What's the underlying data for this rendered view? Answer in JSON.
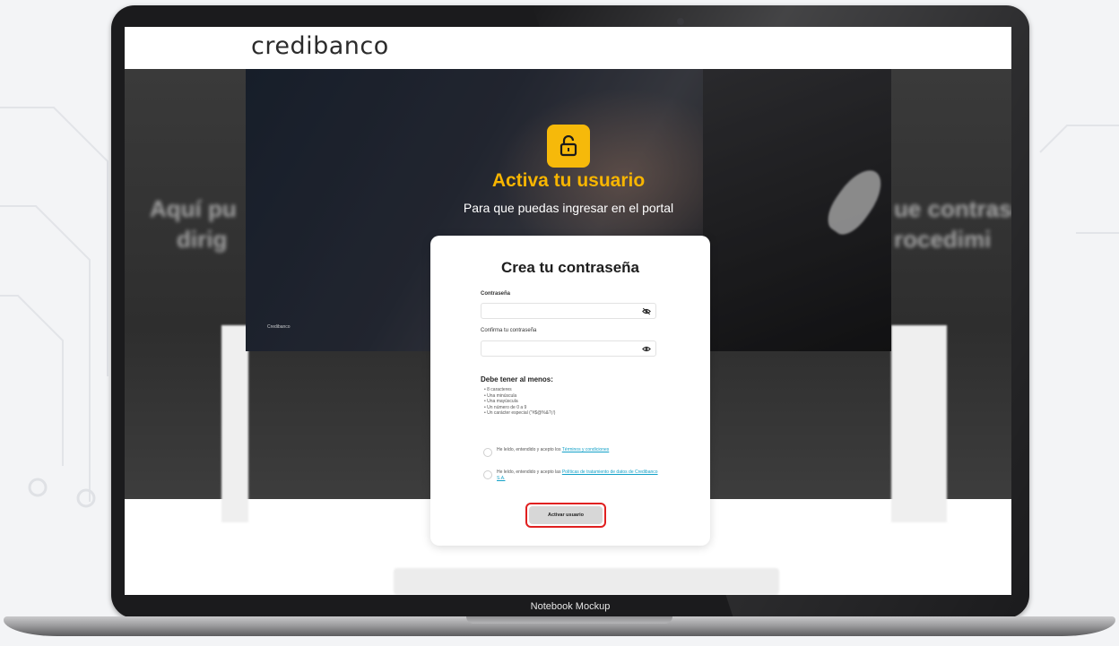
{
  "site": {
    "logo_text": "credibanco",
    "side_text_left_1": "Aquí pu",
    "side_text_left_2": "dirig",
    "side_text_right_1": "ue contrase",
    "side_text_right_2": "rocedimi"
  },
  "hero": {
    "title": "Activa tu usuario",
    "subtitle": "Para que puedas ingresar en el portal",
    "credit": "Credibanco",
    "lock_icon": "unlock-icon"
  },
  "form": {
    "title": "Crea tu contraseña",
    "password_label": "Contraseña",
    "password_value": "",
    "confirm_label": "Confirma tu contraseña",
    "confirm_value": "",
    "requirements_title": "Debe tener al menos:",
    "requirements": [
      "• 8 caracteres",
      "• Una minúscula",
      "• Una mayúscula",
      "• Un número de 0 a 9",
      "• Un carácter especial (\"#$@%&?¡!)"
    ],
    "terms_prefix": "He leído, entendido y acepto los ",
    "terms_link": "Términos y condiciones",
    "privacy_prefix": "He leído, entendido y acepto las ",
    "privacy_link": "Políticas de tratamiento de datos de Credibanco S.A.",
    "submit_label": "Activar usuario"
  },
  "caption": "Notebook Mockup",
  "colors": {
    "accent_yellow": "#f6b90a",
    "highlight_red": "#e02020",
    "link_teal": "#13a1c8"
  }
}
